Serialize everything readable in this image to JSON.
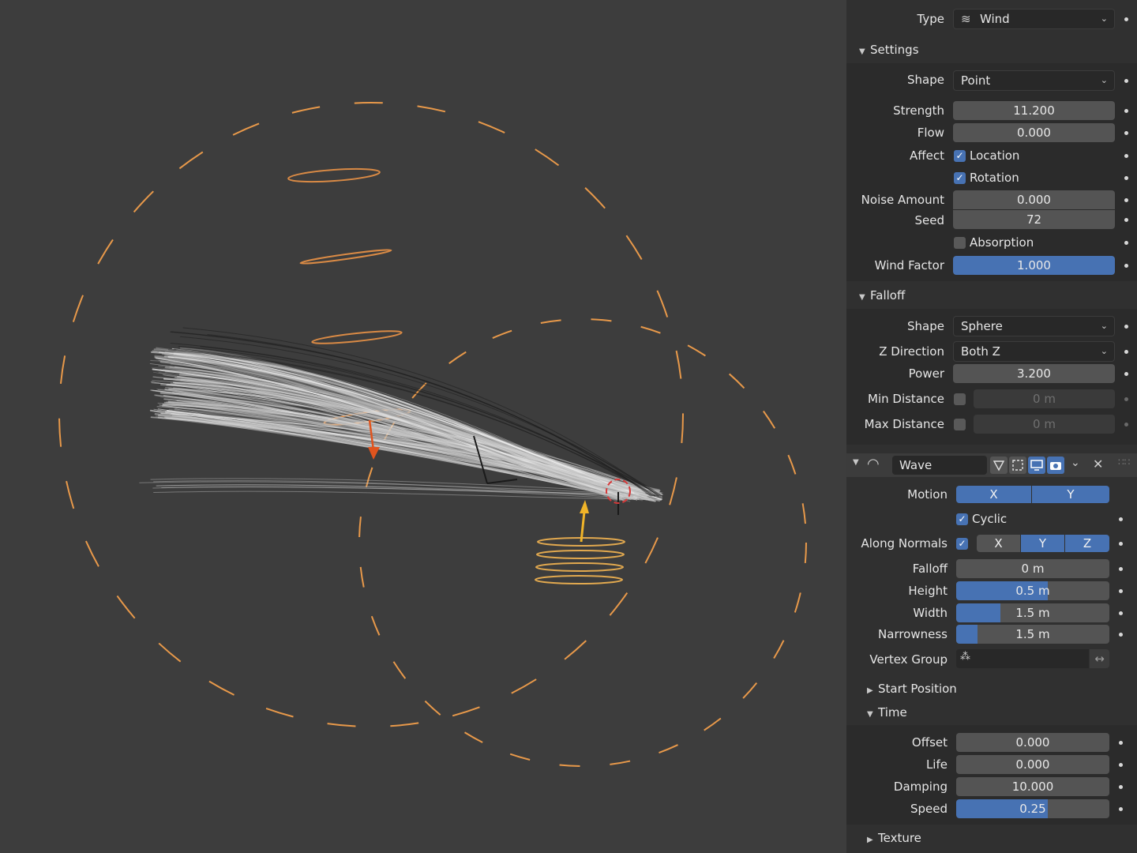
{
  "colors": {
    "accent": "#4772b3",
    "viewport_bg": "#3d3d3d",
    "panel_bg": "#303030",
    "dash_orange": "#e8994a",
    "curve_orange": "#d98a45",
    "arrow_red": "#e0541e",
    "arrow_yellow": "#f0b429"
  },
  "viewport": {
    "icons": [
      "wind-field-circle",
      "wave-field-circle",
      "hair-strands"
    ]
  },
  "field": {
    "type_label": "Type",
    "type_value": "Wind",
    "type_icon": "wind-icon"
  },
  "settings": {
    "title": "Settings",
    "shape_label": "Shape",
    "shape_value": "Point",
    "strength_label": "Strength",
    "strength_value": "11.200",
    "flow_label": "Flow",
    "flow_value": "0.000",
    "affect_label": "Affect",
    "location_label": "Location",
    "location_checked": true,
    "rotation_label": "Rotation",
    "rotation_checked": true,
    "noise_label": "Noise Amount",
    "noise_value": "0.000",
    "seed_label": "Seed",
    "seed_value": "72",
    "absorption_label": "Absorption",
    "absorption_checked": false,
    "wind_factor_label": "Wind Factor",
    "wind_factor_value": "1.000",
    "wind_factor_fill": 1.0
  },
  "falloff": {
    "title": "Falloff",
    "shape_label": "Shape",
    "shape_value": "Sphere",
    "zdir_label": "Z Direction",
    "zdir_value": "Both Z",
    "power_label": "Power",
    "power_value": "3.200",
    "min_label": "Min Distance",
    "min_value": "0 m",
    "max_label": "Max Distance",
    "max_value": "0 m"
  },
  "wave": {
    "name": "Wave",
    "motion_label": "Motion",
    "motion_x": "X",
    "motion_y": "Y",
    "cyclic_label": "Cyclic",
    "along_normals_label": "Along Normals",
    "an_x": "X",
    "an_y": "Y",
    "an_z": "Z",
    "falloff_label": "Falloff",
    "falloff_value": "0 m",
    "height_label": "Height",
    "height_value": "0.5 m",
    "height_fill": 0.6,
    "width_label": "Width",
    "width_value": "1.5 m",
    "width_fill": 0.29,
    "narrowness_label": "Narrowness",
    "narrowness_value": "1.5 m",
    "narrowness_fill": 0.14,
    "vgroup_label": "Vertex Group",
    "start_position_title": "Start Position",
    "time_title": "Time",
    "offset_label": "Offset",
    "offset_value": "0.000",
    "life_label": "Life",
    "life_value": "0.000",
    "damping_label": "Damping",
    "damping_value": "10.000",
    "speed_label": "Speed",
    "speed_value": "0.25",
    "speed_fill": 0.6,
    "texture_title": "Texture"
  }
}
